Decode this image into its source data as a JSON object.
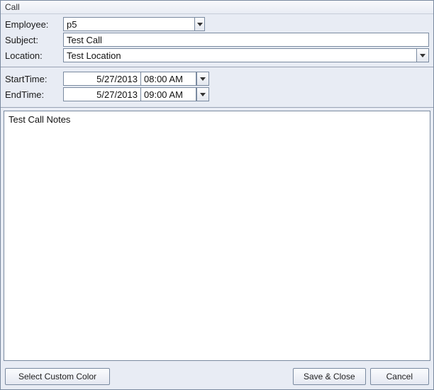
{
  "window": {
    "title": "Call"
  },
  "form": {
    "employee_label": "Employee:",
    "employee_value": "p5",
    "subject_label": "Subject:",
    "subject_value": "Test Call",
    "location_label": "Location:",
    "location_value": "Test Location"
  },
  "time": {
    "start_label": "StartTime:",
    "start_date": "5/27/2013",
    "start_time": "08:00 AM",
    "end_label": "EndTime:",
    "end_date": "5/27/2013",
    "end_time": "09:00 AM"
  },
  "notes": {
    "value": "Test Call Notes"
  },
  "buttons": {
    "select_color": "Select Custom Color",
    "save_close": "Save & Close",
    "cancel": "Cancel"
  },
  "icons": {
    "chevron_down": "chevron-down-icon"
  }
}
